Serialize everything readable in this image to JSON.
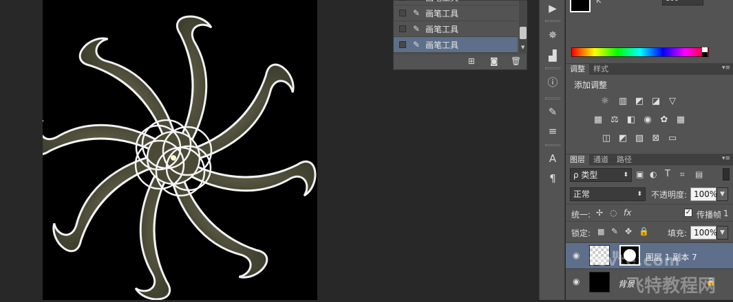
{
  "history": {
    "items": [
      {
        "label": "画笔工具",
        "selected": false
      },
      {
        "label": "画笔工具",
        "selected": false
      },
      {
        "label": "画笔工具",
        "selected": true
      }
    ]
  },
  "iconbar": {
    "icons": [
      "play-icon",
      "compass-icon",
      "histogram-icon",
      "info-icon",
      "brushes-icon",
      "brush-presets-icon",
      "character-icon",
      "paragraph-icon"
    ]
  },
  "color": {
    "channel_label": "K",
    "value": "100"
  },
  "adjustments": {
    "tabs": [
      "调整",
      "样式"
    ],
    "title": "添加调整"
  },
  "layers": {
    "tabs": [
      "图层",
      "通道",
      "路径"
    ],
    "filter_kind": "ρ 类型",
    "blend_mode": "正常",
    "opacity_label": "不透明度:",
    "opacity_value": "100%",
    "unify_label": "统一:",
    "propagate_label": "传播帧",
    "propagate_value": "1",
    "lock_label": "锁定:",
    "fill_label": "填充:",
    "fill_value": "100%",
    "rows": [
      {
        "name": "图层 1 副本 7",
        "selected": true
      },
      {
        "name": "背景",
        "selected": false
      }
    ]
  },
  "watermark": {
    "text_left": "fevte.com",
    "text_right": "飞特教程网"
  },
  "colors": {
    "panel": "#535353",
    "selection": "#5d6f8a",
    "flower_fill": "#4a4a36"
  }
}
